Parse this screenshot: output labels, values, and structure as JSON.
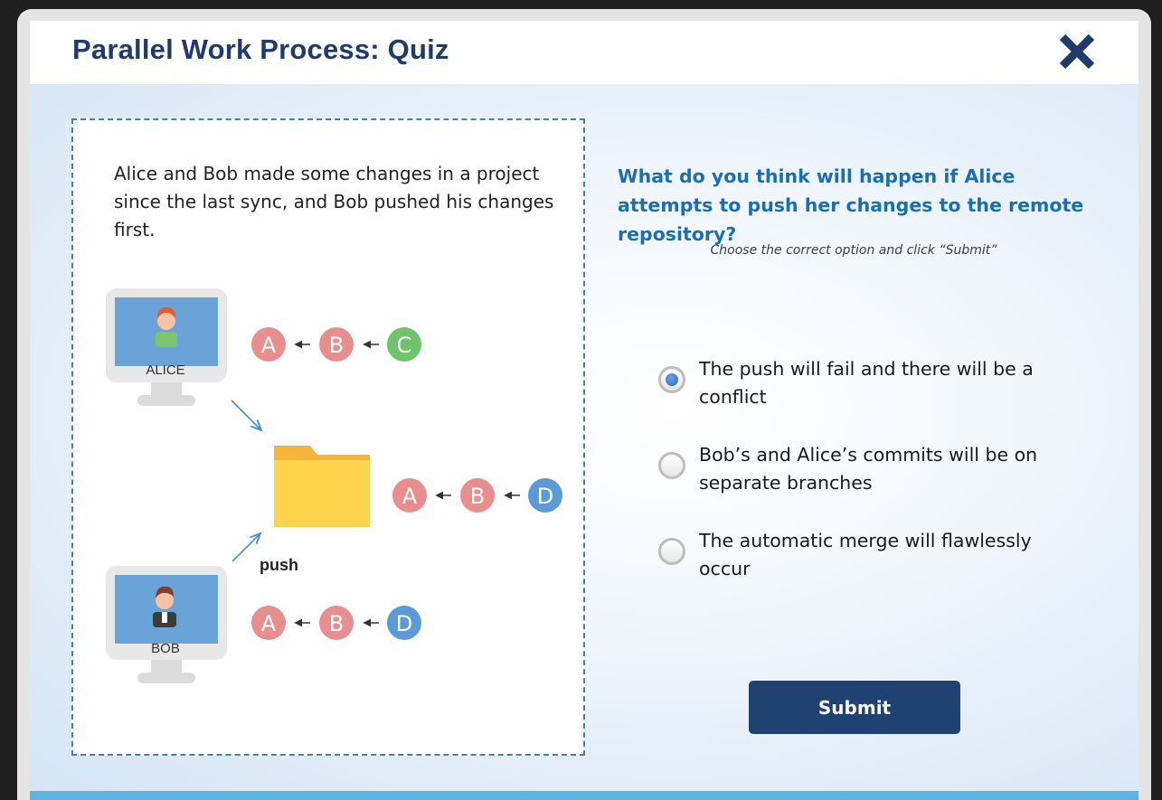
{
  "modal": {
    "title": "Parallel Work Process: Quiz"
  },
  "scenario": {
    "text": "Alice and Bob made some changes in a project since the last sync, and Bob pushed his changes first."
  },
  "diagram": {
    "alice_label": "ALICE",
    "bob_label": "BOB",
    "push_label": "push",
    "alice_commits": [
      "A",
      "B",
      "C"
    ],
    "remote_commits": [
      "A",
      "B",
      "D"
    ],
    "bob_commits": [
      "A",
      "B",
      "D"
    ],
    "colors": {
      "commit_red": "#e88e8e",
      "commit_green": "#6fc46b",
      "commit_blue": "#5b9ad8",
      "folder": "#fcd34d",
      "monitor_screen": "#6aa3d8",
      "arrow": "#4a8fd4"
    }
  },
  "quiz": {
    "question": "What do you think will happen if Alice attempts to push her changes to the remote repository?",
    "instruction": "Choose the correct option and click “Submit”",
    "options": [
      {
        "label": "The push will fail and there will be a conflict",
        "selected": true
      },
      {
        "label": "Bob’s and Alice’s commits will be on separate branches",
        "selected": false
      },
      {
        "label": "The automatic merge will flawlessly occur",
        "selected": false
      }
    ],
    "submit_label": "Submit"
  },
  "colors": {
    "title": "#1f3b6b",
    "question": "#1a6fb3",
    "submit_bg": "#1f4273",
    "bottom_bar": "#5cb6e4"
  },
  "icons": {
    "close": "close-x-icon",
    "alice_computer": "computer-icon",
    "bob_computer": "computer-icon",
    "repository": "folder-icon"
  }
}
